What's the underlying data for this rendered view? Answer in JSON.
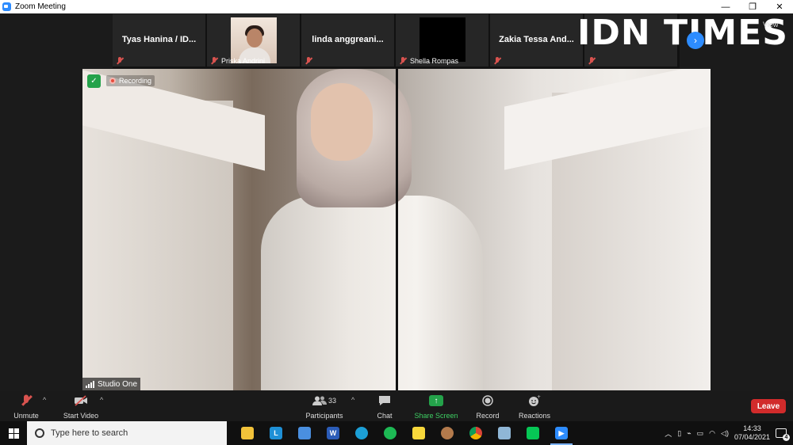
{
  "window": {
    "title": "Zoom Meeting",
    "minimize": "—",
    "restore": "❐",
    "close": "✕"
  },
  "gallery": {
    "tiles": [
      {
        "name": "Tyas Hanina / ID..."
      },
      {
        "name": "Priska Andrini"
      },
      {
        "name": "linda  anggreani..."
      },
      {
        "name": "Shella Rompas"
      },
      {
        "name": "Zakia Tessa And..."
      }
    ],
    "view_label": "View"
  },
  "watermark": "IDN TIMES",
  "video": {
    "recording_label": "Recording",
    "speaker_label": "Studio One"
  },
  "toolbar": {
    "unmute": "Unmute",
    "start_video": "Start Video",
    "participants": "Participants",
    "participants_count": "33",
    "chat": "Chat",
    "share_screen": "Share Screen",
    "record": "Record",
    "reactions": "Reactions",
    "leave": "Leave"
  },
  "taskbar": {
    "search_placeholder": "Type here to search",
    "time": "14:33",
    "date": "07/04/2021",
    "notification_count": "4"
  },
  "colors": {
    "zoom_blue": "#2d8cff",
    "leave_red": "#d12b2b",
    "share_green": "#24a24a"
  }
}
